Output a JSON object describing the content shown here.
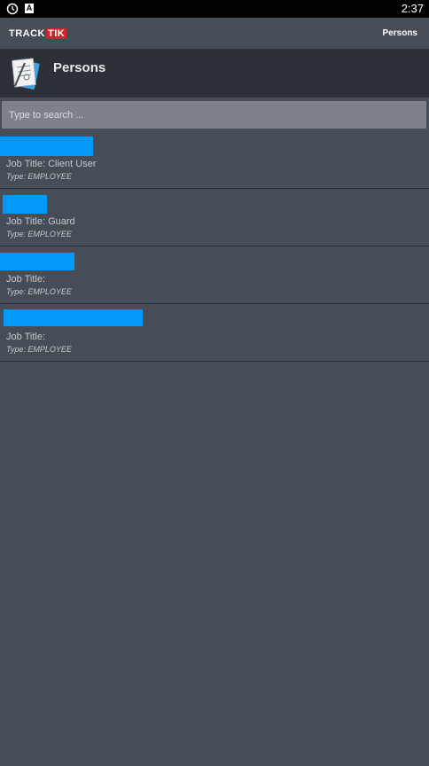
{
  "status_bar": {
    "time": "2:37",
    "icons": [
      "clock-icon",
      "a-notification-icon"
    ]
  },
  "app_bar": {
    "logo_part1": "TRACK",
    "logo_part2": "TIK",
    "title": "Persons"
  },
  "header": {
    "icon": "persons-clipboard-icon",
    "title": "Persons"
  },
  "search": {
    "placeholder": "Type to search ..."
  },
  "persons": [
    {
      "job_title": "Job Title: Client User",
      "type": "Type: EMPLOYEE"
    },
    {
      "job_title": "Job Title: Guard",
      "type": "Type: EMPLOYEE"
    },
    {
      "job_title": "Job Title:",
      "type": "Type: EMPLOYEE"
    },
    {
      "job_title": "Job Title:",
      "type": "Type: EMPLOYEE"
    }
  ],
  "colors": {
    "background": "#474d57",
    "header": "#2c3138",
    "redaction": "#0299fc",
    "logo_red": "#d2232a"
  }
}
